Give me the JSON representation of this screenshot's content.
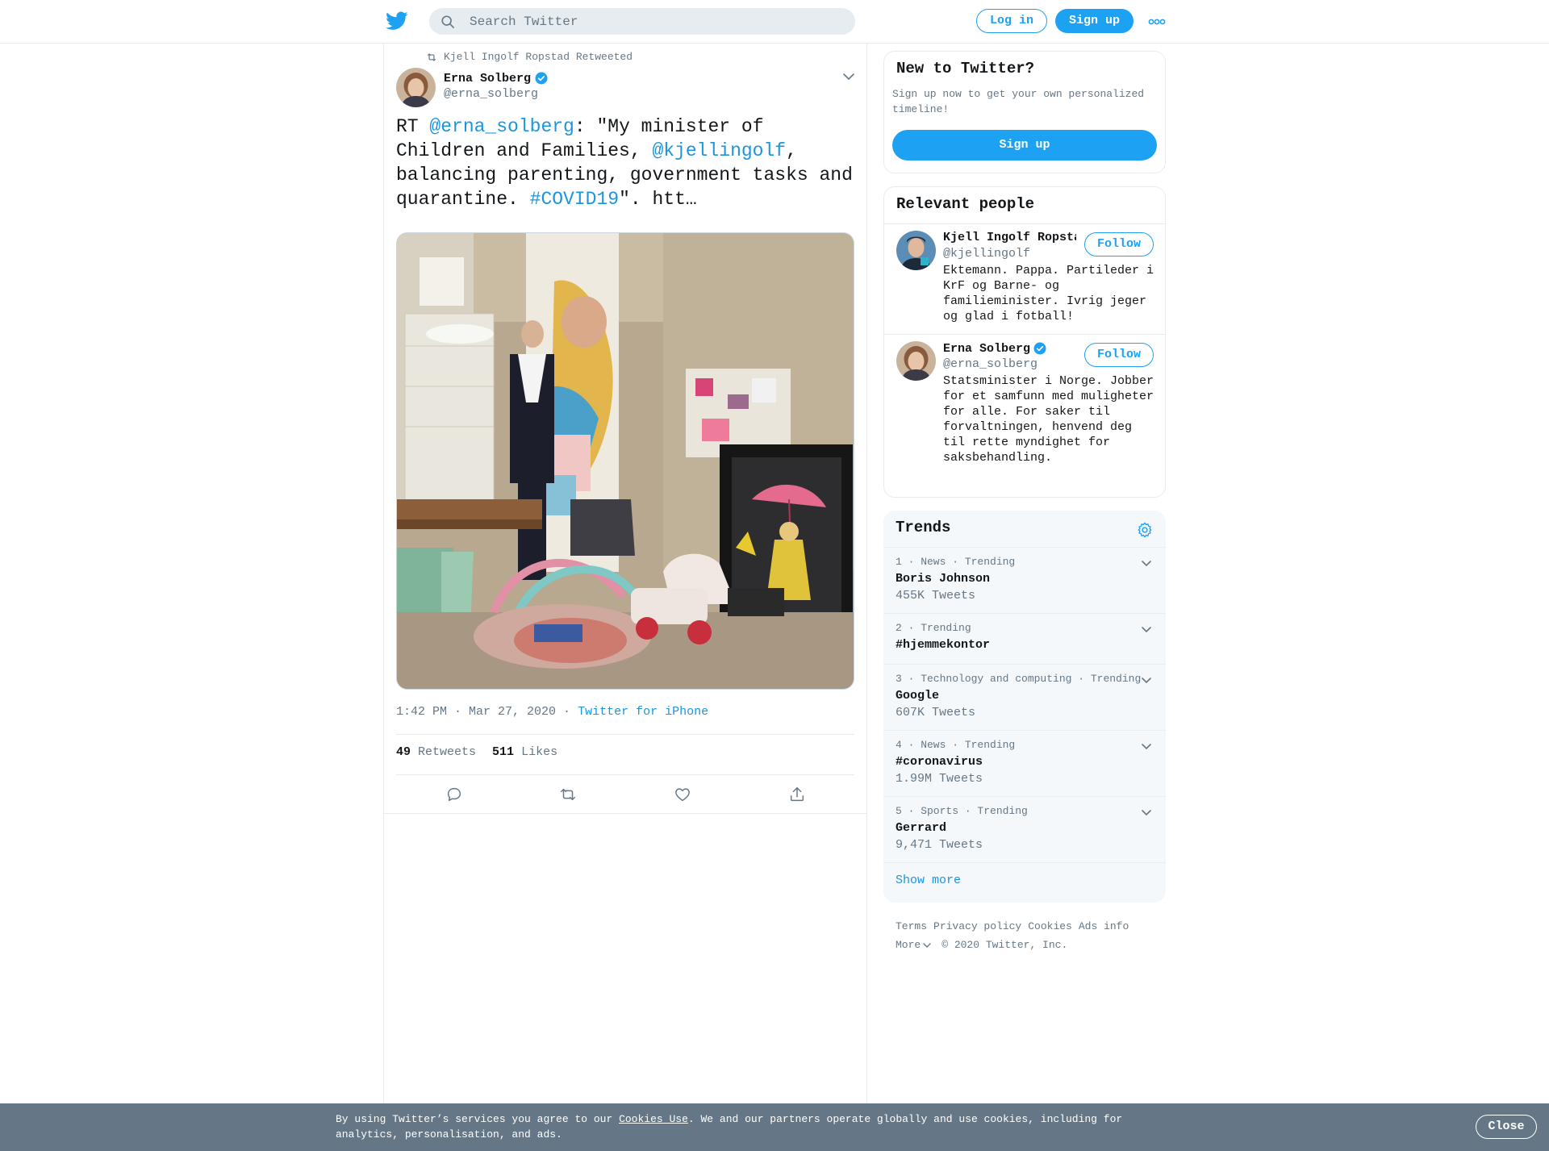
{
  "colors": {
    "accent": "#1da1f2",
    "link": "#1b95e0",
    "muted": "#657786",
    "cookie_bg": "#657786"
  },
  "header": {
    "logo_icon": "twitter-bird-icon",
    "search_placeholder": "Search Twitter",
    "login_label": "Log in",
    "signup_label": "Sign up",
    "more_icon": "more-dots-icon"
  },
  "tweet": {
    "retweet_label": "Kjell Ingolf Ropstad Retweeted",
    "author_name": "Erna Solberg",
    "author_handle": "@erna_solberg",
    "text_prefix": "RT ",
    "mention1": "@erna_solberg",
    "text_mid1": ": \"My minister of Children and Families, ",
    "mention2": "@kjellingolf",
    "text_mid2": ", balancing parenting, government tasks and quarantine. ",
    "hashtag": "#COVID19",
    "text_suffix": "\". htt…",
    "timestamp": "1:42 PM · Mar 27, 2020",
    "meta_sep": " · ",
    "source": "Twitter for iPhone",
    "retweets_count": "49",
    "retweets_label": "Retweets",
    "likes_count": "511",
    "likes_label": "Likes"
  },
  "sidebar": {
    "new_title": "New to Twitter?",
    "new_sub": "Sign up now to get your own personalized timeline!",
    "new_signup": "Sign up",
    "people_title": "Relevant people",
    "people": [
      {
        "name": "Kjell Ingolf Ropstad",
        "handle": "@kjellingolf",
        "bio": "Ektemann. Pappa. Partileder i KrF og Barne- og familieminister. Ivrig jeger og glad i fotball!",
        "follow": "Follow"
      },
      {
        "name": "Erna Solberg",
        "handle": "@erna_solberg",
        "bio": "Statsminister i Norge. Jobber for et samfunn med muligheter for alle. For saker til forvaltningen, henvend deg til rette myndighet for saksbehandling.",
        "follow": "Follow"
      }
    ],
    "trends_title": "Trends",
    "trends": [
      {
        "meta": "1 · News · Trending",
        "name": "Boris Johnson",
        "count": "455K Tweets"
      },
      {
        "meta": "2 · Trending",
        "name": "#hjemmekontor",
        "count": ""
      },
      {
        "meta": "3 · Technology and computing · Trending",
        "name": "Google",
        "count": "607K Tweets"
      },
      {
        "meta": "4 · News · Trending",
        "name": "#coronavirus",
        "count": "1.99M Tweets"
      },
      {
        "meta": "5 · Sports · Trending",
        "name": "Gerrard",
        "count": "9,471 Tweets"
      }
    ],
    "show_more": "Show more"
  },
  "footer": {
    "terms": "Terms",
    "privacy": "Privacy policy",
    "cookies": "Cookies",
    "ads": "Ads info",
    "more": "More",
    "copyright": "© 2020 Twitter, Inc."
  },
  "cookie_bar": {
    "text_before": "By using Twitter’s services you agree to our ",
    "link": "Cookies Use",
    "text_after": ". We and our partners operate globally and use cookies, including for analytics, personalisation, and ads.",
    "close": "Close"
  }
}
